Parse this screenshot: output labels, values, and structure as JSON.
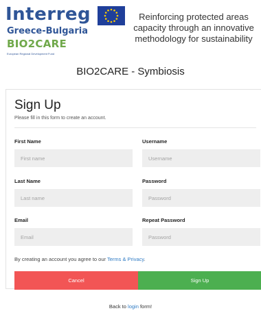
{
  "header": {
    "logo": {
      "brand": "Interreg",
      "programme": "Greece-Bulgaria",
      "project": "BIO2CARE",
      "fund": "European Regional Development Fund"
    },
    "tagline": [
      "Reinforcing protected areas",
      "capacity through an innovative",
      "methodology for sustainability"
    ]
  },
  "site_title": "BIO2CARE - Symbiosis",
  "form": {
    "title": "Sign Up",
    "subtitle": "Please fill in this form to create an account.",
    "first_name": {
      "label": "First Name",
      "placeholder": "First name",
      "value": ""
    },
    "username": {
      "label": "Username",
      "placeholder": "Username",
      "value": ""
    },
    "last_name": {
      "label": "Last Name",
      "placeholder": "Last name",
      "value": ""
    },
    "password": {
      "label": "Password",
      "placeholder": "Password",
      "value": ""
    },
    "email": {
      "label": "Email",
      "placeholder": "Email",
      "value": ""
    },
    "repeat_password": {
      "label": "Repeat Password",
      "placeholder": "Password",
      "value": ""
    },
    "terms_prefix": "By creating an account you agree to our ",
    "terms_link": "Terms & Privacy",
    "terms_suffix": ".",
    "cancel_label": "Cancel",
    "signup_label": "Sign Up"
  },
  "footer": {
    "back_prefix": "Back to ",
    "back_link": "login",
    "back_suffix": " form!"
  },
  "colors": {
    "brand_blue": "#2f5597",
    "brand_green": "#6fa84a",
    "cancel": "#f25555",
    "signup": "#4caf50",
    "link": "#2f7bc4",
    "input_bg": "#eeeeee"
  },
  "icons": {
    "eu_flag": "eu-flag-icon"
  }
}
